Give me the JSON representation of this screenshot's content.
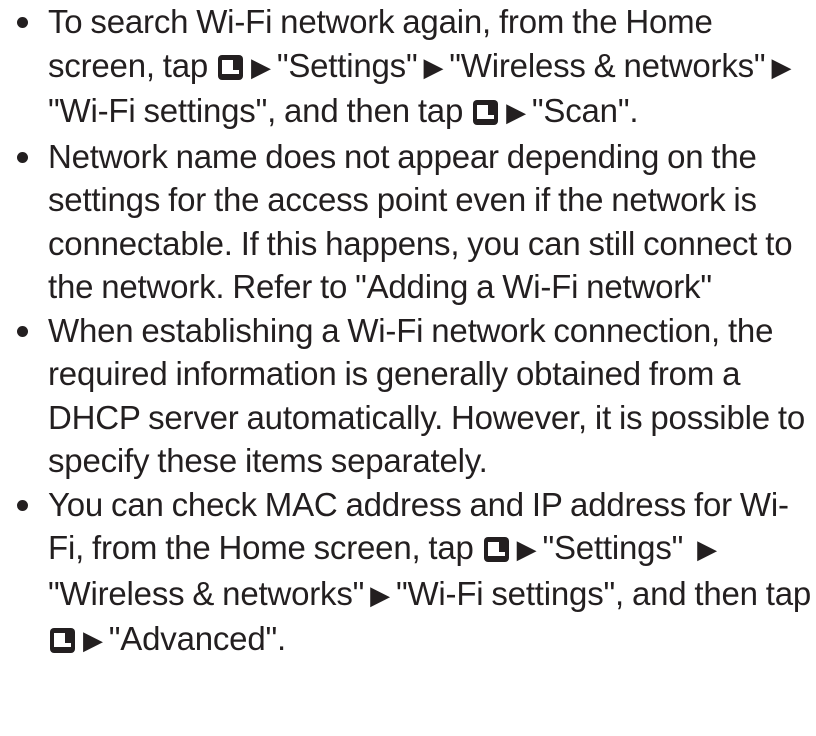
{
  "icons": {
    "menu_key": "menu-key-icon",
    "arrow": "▶"
  },
  "bullets": [
    {
      "s1": "To search Wi-Fi network again, from the Home screen, tap",
      "s2": "\"Settings\"",
      "s3": "\"Wireless & networks\"",
      "s4": "\"Wi-Fi settings\", and then tap",
      "s5": "\"Scan\"."
    },
    {
      "text": "Network name does not appear depending on the settings for the access point even if the network is connectable. If this happens, you can still connect to the network. Refer to \"Adding a Wi-Fi network\""
    },
    {
      "text": "When establishing a Wi-Fi network connection, the required information is generally obtained from a DHCP server automatically. However, it is possible to specify these items separately."
    },
    {
      "s1": "You can check MAC address and IP address for Wi-Fi, from the Home screen, tap",
      "s2": "\"Settings\"",
      "s3": "\"Wireless & networks\"",
      "s4": "\"Wi-Fi settings\", and then tap",
      "s5": "\"Advanced\"."
    }
  ]
}
